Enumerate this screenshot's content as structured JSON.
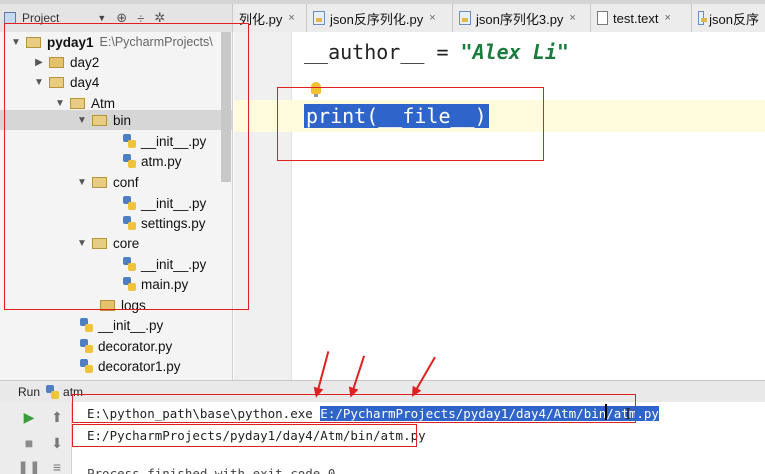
{
  "project_panel": {
    "title": "Project",
    "dropdown_glyph": "▼",
    "tools": [
      "⊕",
      "÷",
      "✲"
    ]
  },
  "tabs": [
    {
      "label": "列化.py",
      "icon": "python-file-icon"
    },
    {
      "label": "json反序列化.py",
      "icon": "python-file-icon"
    },
    {
      "label": "json序列化3.py",
      "icon": "python-file-icon"
    },
    {
      "label": "test.text",
      "icon": "text-file-icon"
    },
    {
      "label": "json反序",
      "icon": "python-file-icon"
    }
  ],
  "tab_close_glyph": "×",
  "tree": {
    "root": {
      "name": "pyday1",
      "path": "E:\\PycharmProjects\\"
    },
    "items": [
      {
        "name": "day2"
      },
      {
        "name": "day4"
      },
      {
        "name": "Atm"
      },
      {
        "name": "bin"
      },
      {
        "name": "__init__.py"
      },
      {
        "name": "atm.py"
      },
      {
        "name": "conf"
      },
      {
        "name": "__init__.py"
      },
      {
        "name": "settings.py"
      },
      {
        "name": "core"
      },
      {
        "name": "__init__.py"
      },
      {
        "name": "main.py"
      },
      {
        "name": "logs"
      },
      {
        "name": "__init__.py"
      },
      {
        "name": "decorator.py"
      },
      {
        "name": "decorator1.py"
      }
    ]
  },
  "editor": {
    "line1_prefix": "__author__ = ",
    "line1_string": "\"Alex Li\"",
    "line2": "print(__file__)"
  },
  "run": {
    "label": "Run",
    "config": "atm",
    "output_interpreter": "E:\\python_path\\base\\python.exe ",
    "output_script": "E:/PycharmProjects/pyday1/day4/Atm/bin/atm.py",
    "output_line2": "E:/PycharmProjects/pyday1/day4/Atm/bin/atm.py",
    "output_line3": "Process finished with exit code 0"
  },
  "colors": {
    "annotation": "#e02020",
    "selection": "#2f65ca",
    "string": "#1c7c3e"
  }
}
